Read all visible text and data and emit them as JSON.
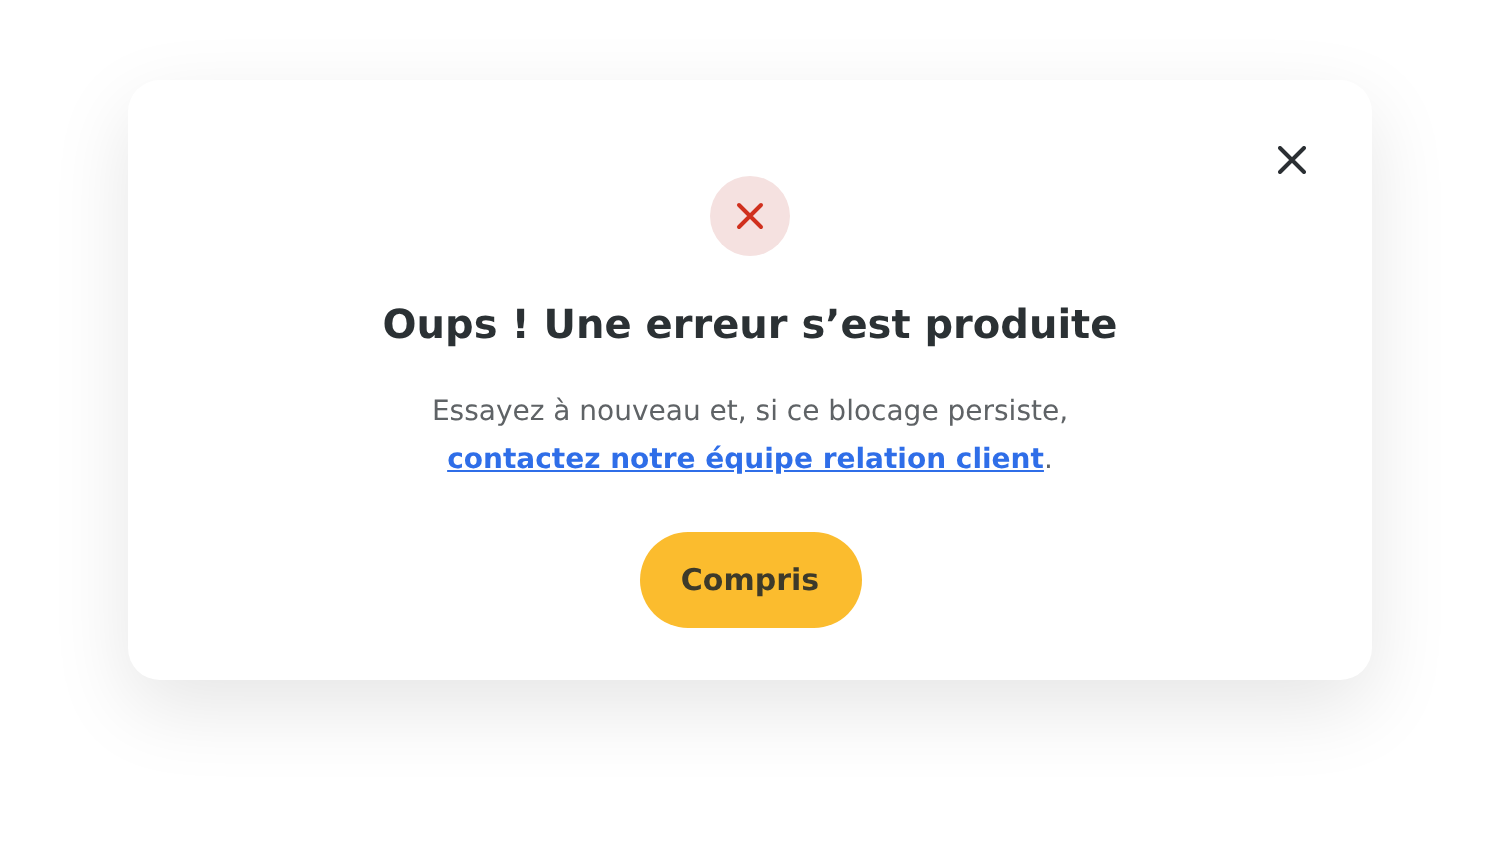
{
  "dialog": {
    "title": "Oups ! Une erreur s’est produite",
    "message": {
      "text": "Essayez à nouveau et, si ce blocage persiste,",
      "link": "contactez notre équipe relation client",
      "after": "."
    },
    "button": "Compris"
  }
}
